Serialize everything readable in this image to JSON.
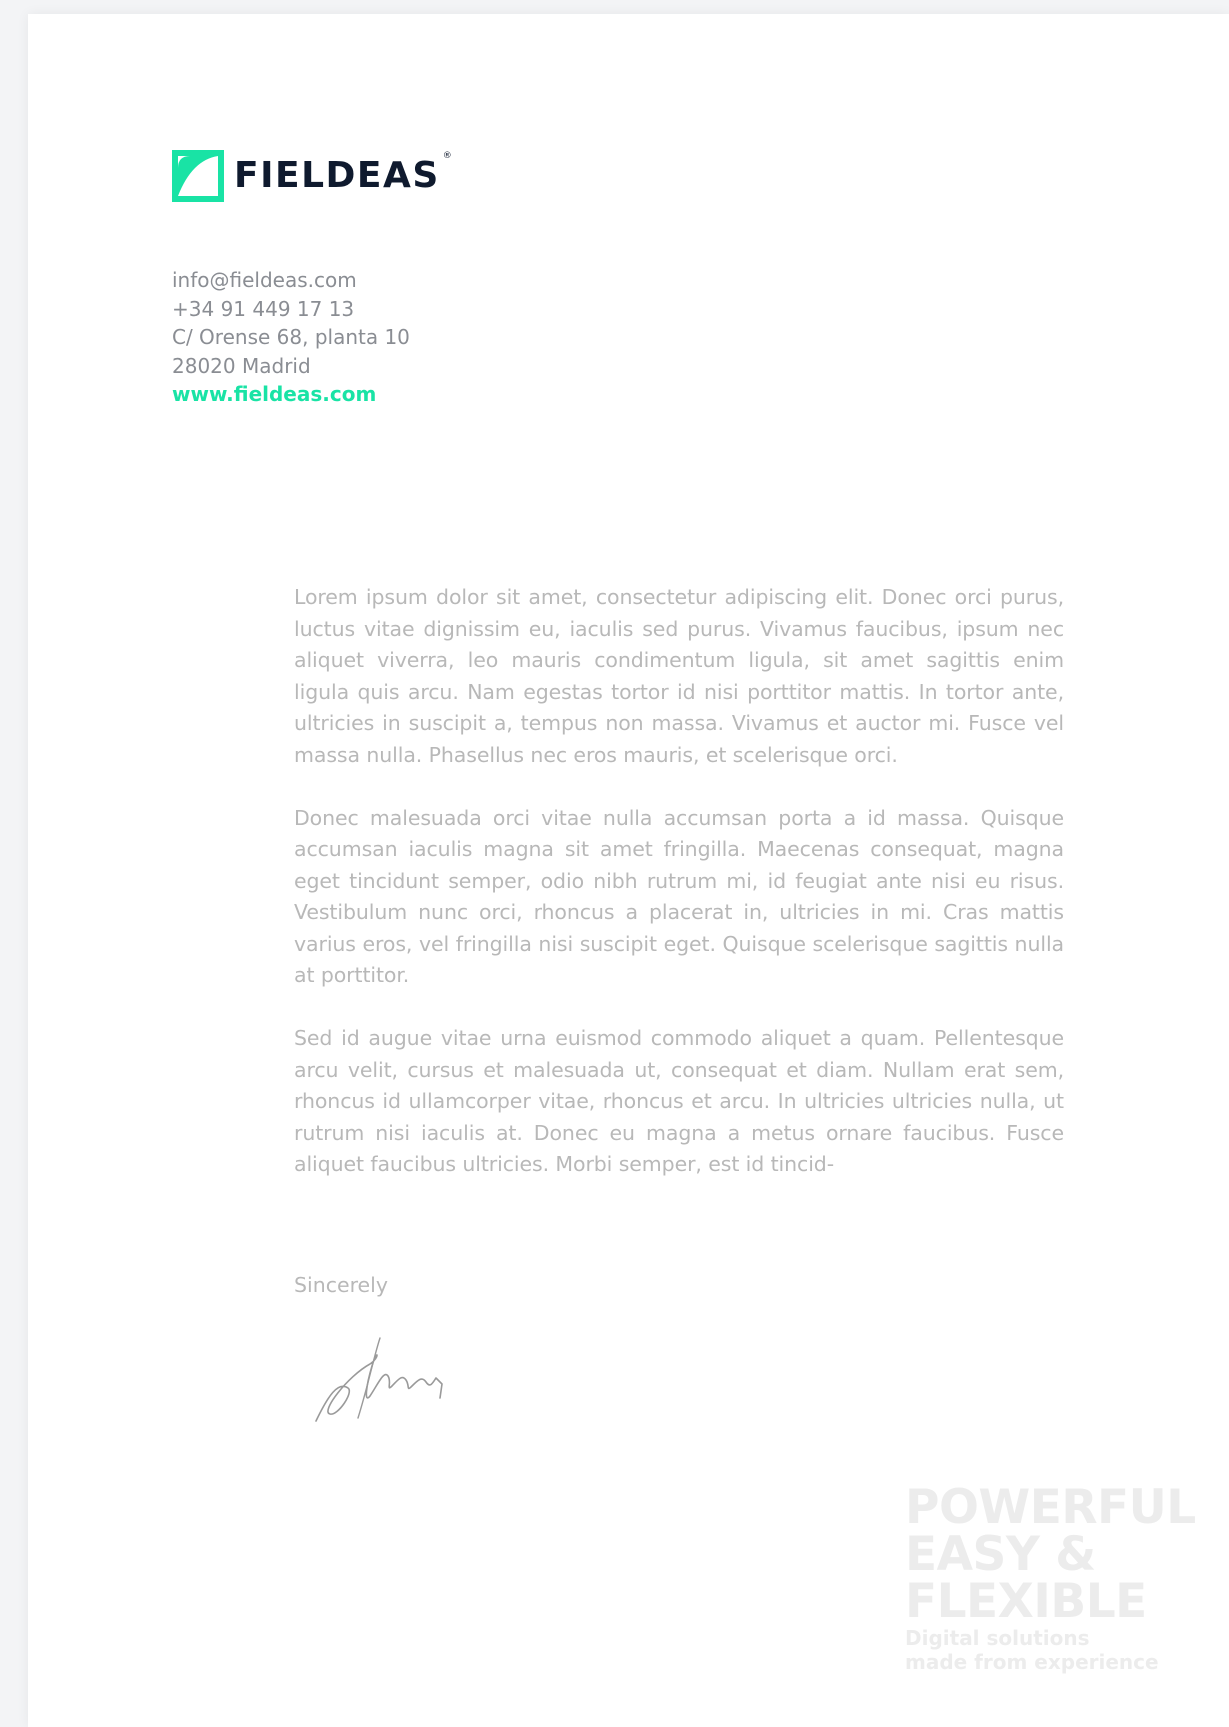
{
  "brand": {
    "name": "FIELDEAS",
    "registered_mark": "®",
    "accent_color": "#19e3a5",
    "dark_color": "#0f1a2e"
  },
  "contact": {
    "email": "info@fieldeas.com",
    "phone": "+34 91 449 17 13",
    "address_line1": "C/ Orense 68, planta 10",
    "address_line2": "28020 Madrid",
    "website": "www.fieldeas.com"
  },
  "letter": {
    "paragraphs": [
      "Lorem ipsum dolor sit amet, consectetur adipiscing elit. Donec orci purus, luctus vitae dignissim eu, iaculis sed purus. Vivamus faucibus, ipsum nec aliquet viverra, leo mauris condimentum ligula, sit amet sagittis enim ligula quis arcu. Nam egestas tortor id nisi porttitor mattis. In tortor ante, ultricies in suscipit a, tempus non massa. Vivamus et auctor mi. Fusce vel massa nulla. Phasellus nec eros mauris, et scelerisque orci.",
      "Donec malesuada orci vitae nulla accumsan porta a id massa. Quisque accumsan iaculis magna sit amet fringilla. Maecenas consequat, magna eget tincidunt semper, odio nibh rutrum mi, id feugiat ante nisi eu risus. Vestibulum nunc orci, rhoncus a placerat in, ultricies in mi. Cras mattis varius eros, vel fringilla nisi suscipit eget. Quisque scelerisque sagittis nulla at porttitor.",
      "Sed id augue vitae urna euismod commodo aliquet a quam. Pellentesque arcu velit, cursus et malesuada ut, consequat et diam. Nullam erat sem, rhoncus id ullamcorper vitae, rhoncus et arcu. In ultricies ultricies nulla, ut rutrum nisi iaculis at. Donec eu magna a metus ornare faucibus. Fusce aliquet faucibus ultricies. Morbi semper, est id tincid-"
    ],
    "closing": "Sincerely"
  },
  "tagline": {
    "line1": "POWERFUL",
    "line2": "EASY &",
    "line3": "FLEXIBLE",
    "sub1": "Digital solutions",
    "sub2": "made from experience"
  }
}
